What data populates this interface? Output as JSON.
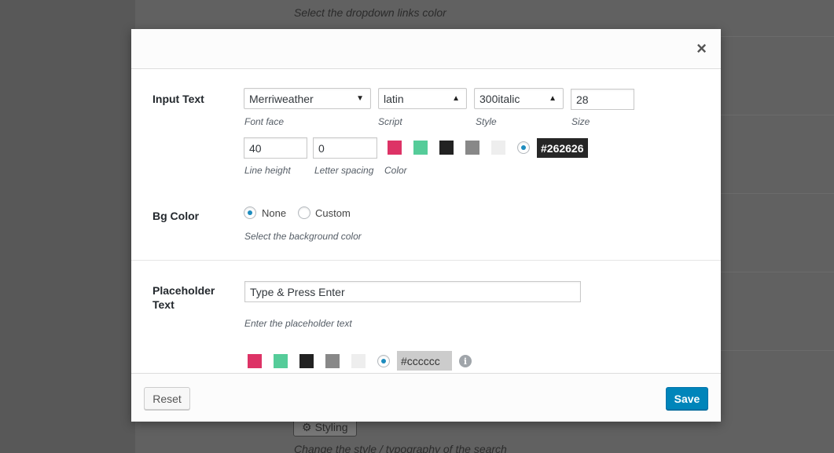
{
  "background_page": {
    "top_note": "Select the dropdown links color",
    "styling_button": "Styling",
    "bottom_note": "Change the style / typography of the search"
  },
  "modal": {
    "close_symbol": "×",
    "input_text": {
      "label": "Input Text",
      "font_face": {
        "value": "Merriweather",
        "hint": "Font face"
      },
      "script": {
        "value": "latin",
        "hint": "Script"
      },
      "style": {
        "value": "300italic",
        "hint": "Style"
      },
      "size": {
        "value": "28",
        "hint": "Size"
      },
      "line_height": {
        "value": "40",
        "hint": "Line height"
      },
      "letter_spacing": {
        "value": "0",
        "hint": "Letter spacing"
      },
      "color": {
        "hint": "Color",
        "swatches": [
          "#dd3366",
          "#55cc99",
          "#222222",
          "#888888",
          "#eeeeee"
        ],
        "value": "#262626",
        "custom_selected": true
      }
    },
    "bg_color": {
      "label": "Bg Color",
      "options": [
        {
          "label": "None",
          "selected": true
        },
        {
          "label": "Custom",
          "selected": false
        }
      ],
      "hint": "Select the background color"
    },
    "placeholder_text": {
      "label_line1": "Placeholder",
      "label_line2": "Text",
      "value": "Type & Press Enter",
      "hint": "Enter the placeholder text",
      "color": {
        "swatches": [
          "#dd3366",
          "#55cc99",
          "#222222",
          "#888888",
          "#eeeeee"
        ],
        "value": "#cccccc",
        "custom_selected": true
      }
    },
    "footer": {
      "reset_label": "Reset",
      "save_label": "Save"
    }
  }
}
